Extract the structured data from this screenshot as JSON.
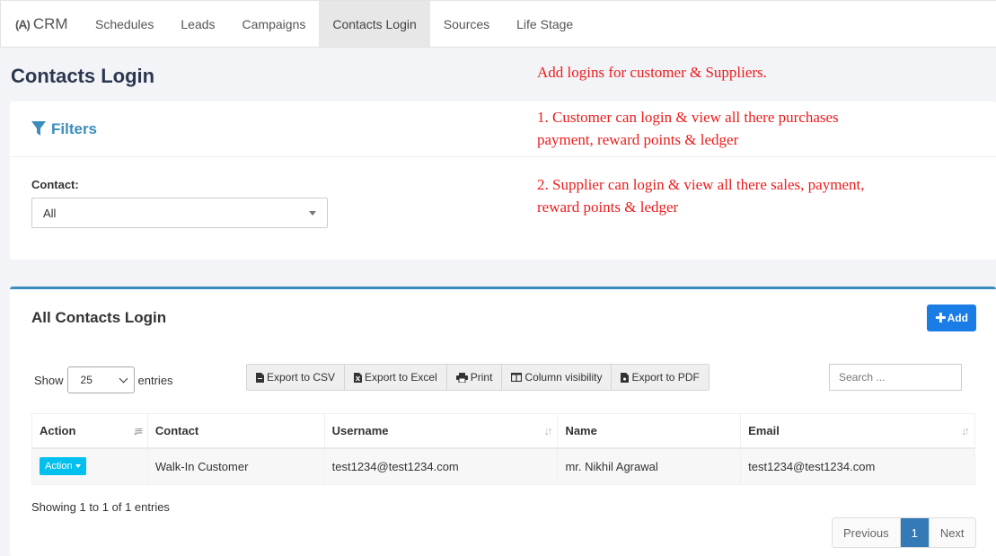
{
  "nav": {
    "brand": "CRM",
    "items": [
      {
        "label": "Schedules"
      },
      {
        "label": "Leads"
      },
      {
        "label": "Campaigns"
      },
      {
        "label": "Contacts Login",
        "active": true
      },
      {
        "label": "Sources"
      },
      {
        "label": "Life Stage"
      }
    ]
  },
  "page_title": "Contacts Login",
  "annotations": {
    "line1": "Add logins for customer & Suppliers.",
    "line2a": "1. Customer can login & view all there purchases",
    "line2b": "payment, reward points & ledger",
    "line3a": "2. Supplier can login & view all there sales, payment,",
    "line3b": "reward points & ledger",
    "color": "#ee1c1c"
  },
  "filters": {
    "title": "Filters",
    "contact_label": "Contact:",
    "contact_value": "All"
  },
  "list": {
    "title": "All Contacts Login",
    "add_label": "Add",
    "show_label": "Show",
    "entries_label": "entries",
    "page_length": "25",
    "buttons": {
      "csv": "Export to CSV",
      "excel": "Export to Excel",
      "print": "Print",
      "colvis": "Column visibility",
      "pdf": "Export to PDF"
    },
    "search_placeholder": "Search ...",
    "columns": [
      "Action",
      "Contact",
      "Username",
      "Name",
      "Email"
    ],
    "rows": [
      {
        "action": "Action",
        "contact": "Walk-In Customer",
        "username": "test1234@test1234.com",
        "name": "mr. Nikhil Agrawal",
        "email": "test1234@test1234.com"
      }
    ],
    "showing": "Showing 1 to 1 of 1 entries",
    "pagination": {
      "previous": "Previous",
      "current": "1",
      "next": "Next"
    }
  },
  "colors": {
    "accent": "#3c8dbc",
    "add_button": "#1a7de6",
    "action_button": "#00c0ef",
    "page_active": "#337ab7"
  }
}
